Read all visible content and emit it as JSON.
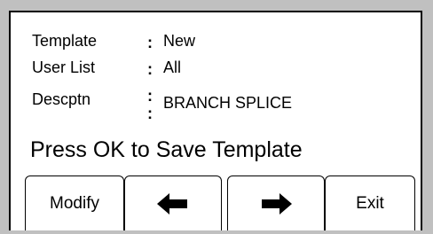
{
  "fields": [
    {
      "label": "Template",
      "value": "New"
    },
    {
      "label": "User List",
      "value": "All"
    },
    {
      "label": "Descptn",
      "value": "BRANCH SPLICE"
    }
  ],
  "colon": ":",
  "message": "Press OK to Save Template",
  "softkeys": {
    "modify_label": "Modify",
    "left_icon": "arrow-left-icon",
    "right_icon": "arrow-right-icon",
    "exit_label": "Exit"
  }
}
